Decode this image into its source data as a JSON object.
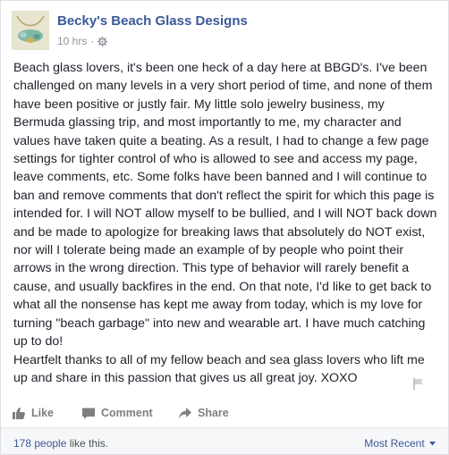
{
  "post": {
    "page_name": "Becky's Beach Glass Designs",
    "timestamp": "10 hrs",
    "separator": "·",
    "privacy_icon": "gear-icon",
    "body": "Beach glass lovers, it's been one heck of a day here at BBGD's. I've been challenged on many levels in a very short period of time, and none of them have been positive or justly fair. My little solo jewelry business, my Bermuda glassing trip, and most importantly to me, my character and values have taken quite a beating. As a result, I had to change a few page settings for tighter control of who is allowed to see and access my page, leave comments, etc. Some folks have been banned and I will continue to ban and remove comments that don't reflect the spirit for which this page is intended for. I will NOT allow myself to be bullied, and I will NOT back down and be made to apologize for breaking laws that absolutely do NOT exist, nor will I tolerate being made an example of by people who point their arrows in the wrong direction. This type of behavior will rarely benefit a cause, and usually backfires in the end. On that note, I'd like to get back to what all the nonsense has kept me away from today, which is my love for turning \"beach garbage\" into new and wearable art. I have much catching up to do!\nHeartfelt thanks to all of my fellow beach and sea glass lovers who lift me up and share in this passion that gives us all great joy. XOXO"
  },
  "actions": {
    "like": "Like",
    "comment": "Comment",
    "share": "Share"
  },
  "footer": {
    "likes_count": "178 people",
    "likes_suffix": " like this.",
    "sort_label": "Most Recent",
    "sort_icon": "caret-down-icon"
  },
  "colors": {
    "link": "#3b5998",
    "text": "#1d2129",
    "muted": "#90949c"
  }
}
